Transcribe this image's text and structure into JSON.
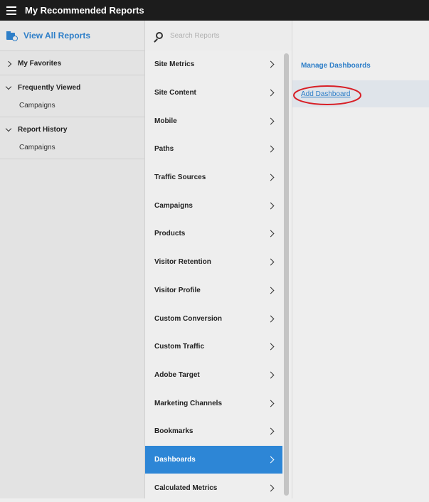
{
  "header": {
    "title": "My Recommended Reports"
  },
  "left": {
    "view_all": "View All Reports",
    "sections": [
      {
        "label": "My Favorites",
        "expanded": false,
        "items": []
      },
      {
        "label": "Frequently Viewed",
        "expanded": true,
        "items": [
          "Campaigns"
        ]
      },
      {
        "label": "Report History",
        "expanded": true,
        "items": [
          "Campaigns"
        ]
      }
    ]
  },
  "search": {
    "placeholder": "Search Reports"
  },
  "menu": {
    "items": [
      "Site Metrics",
      "Site Content",
      "Mobile",
      "Paths",
      "Traffic Sources",
      "Campaigns",
      "Products",
      "Visitor Retention",
      "Visitor Profile",
      "Custom Conversion",
      "Custom Traffic",
      "Adobe Target",
      "Marketing Channels",
      "Bookmarks",
      "Dashboards",
      "Calculated Metrics"
    ],
    "active": "Dashboards"
  },
  "submenu": {
    "manage": "Manage Dashboards",
    "add": "Add Dashboard"
  },
  "colors": {
    "accent": "#2d86d6",
    "link": "#2d7ec8",
    "highlight_oval": "#d81f26"
  }
}
